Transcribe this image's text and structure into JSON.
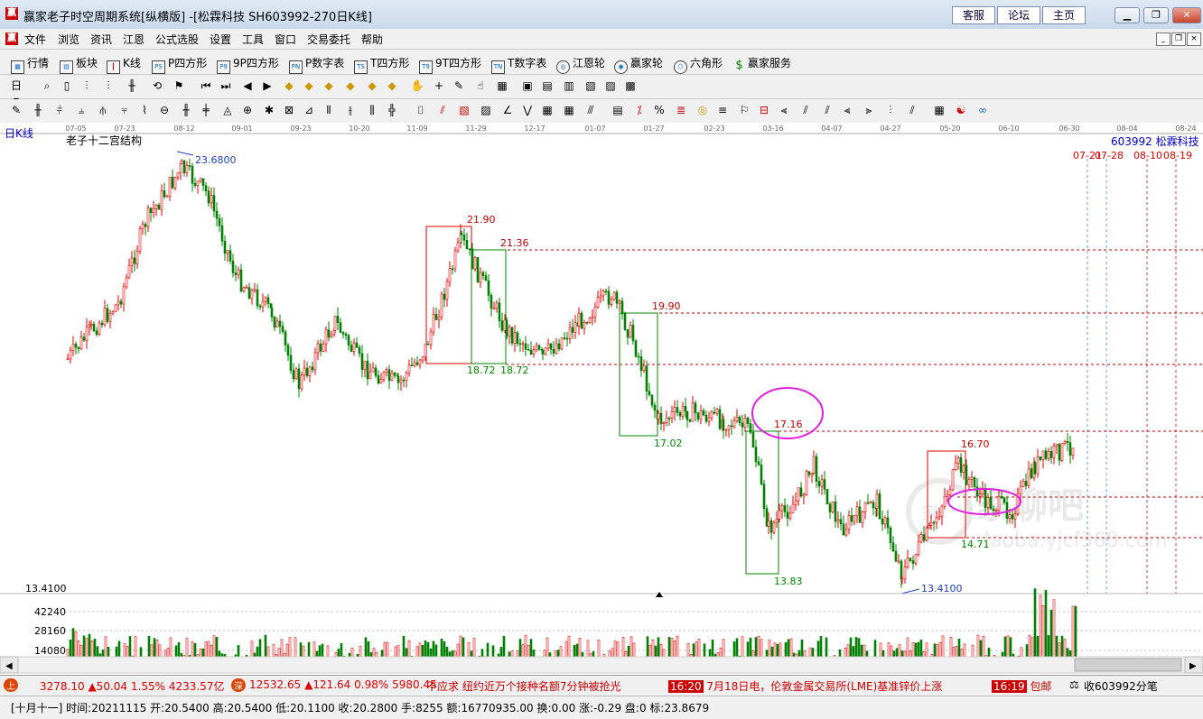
{
  "window": {
    "title": "赢家老子时空周期系统[纵横版] -[松霖科技  SH603992-270日K线]",
    "links": [
      "客服",
      "论坛",
      "主页"
    ]
  },
  "menu": [
    "文件",
    "浏览",
    "资讯",
    "江恩",
    "公式选股",
    "设置",
    "工具",
    "窗口",
    "交易委托",
    "帮助"
  ],
  "toolbar": [
    {
      "label": "行情",
      "icon": "grid-icon"
    },
    {
      "label": "板块",
      "icon": "blocks-icon"
    },
    {
      "label": "K线",
      "icon": "candlestick-icon"
    },
    {
      "label": "P四方形",
      "icon": "ps-square-icon",
      "tag": "PS"
    },
    {
      "label": "9P四方形",
      "icon": "p9-square-icon",
      "tag": "P9"
    },
    {
      "label": "P数字表",
      "icon": "pn-table-icon",
      "tag": "PN"
    },
    {
      "label": "T四方形",
      "icon": "ts-square-icon",
      "tag": "TS"
    },
    {
      "label": "9T四方形",
      "icon": "t9-square-icon",
      "tag": "T9"
    },
    {
      "label": "T数字表",
      "icon": "tn-table-icon",
      "tag": "TN"
    },
    {
      "label": "江恩轮",
      "icon": "gann-wheel-icon"
    },
    {
      "label": "赢家轮",
      "icon": "winner-wheel-icon"
    },
    {
      "label": "六角形",
      "icon": "hexagon-icon"
    },
    {
      "label": "赢家服务",
      "icon": "dollar-icon"
    }
  ],
  "chart": {
    "period_label": "日K线",
    "study_title": "老子十二宫结构",
    "code_label": "603992  松霖科技",
    "date_ticks": [
      "07-05",
      "07-23",
      "08-12",
      "09-01",
      "09-23",
      "10-20",
      "11-09",
      "11-29",
      "12-17",
      "01-07",
      "01-27",
      "02-23",
      "03-16",
      "04-07",
      "04-27",
      "05-20",
      "06-10",
      "06-30",
      "08-04",
      "08-24"
    ],
    "future_dates": [
      "07-21",
      "07-28",
      "08-10",
      "08-19"
    ],
    "left_axis_label": "13.4100",
    "volume_ticks": [
      "42240",
      "28160",
      "14080"
    ],
    "annotations": {
      "high": "23.6800",
      "low": "13.4100",
      "box1_top": "21.90",
      "box1_bottom": "18.72",
      "box2_top": "21.36",
      "box2_bottom": "18.72",
      "box3_top": "19.90",
      "box3_bottom": "17.02",
      "circle1": "17.16",
      "box4_bottom": "13.83",
      "box5_top": "16.70",
      "box5_bottom": "14.71"
    },
    "watermark_main": "家聊吧",
    "watermark_url": "laoba.yjcf360.com",
    "colors": {
      "up": "#e00000",
      "down": "#008000",
      "boxes": "#e00000",
      "dash": "#c00000",
      "ellipse": "#e020e0",
      "blue": "#2040c0"
    }
  },
  "chart_data": {
    "type": "candlestick",
    "x_axis_ticks": [
      "07-05",
      "07-23",
      "08-12",
      "09-01",
      "09-23",
      "10-20",
      "11-09",
      "11-29",
      "12-17",
      "01-07",
      "01-27",
      "02-23",
      "03-16",
      "04-07",
      "04-27",
      "05-20",
      "06-10",
      "06-30",
      "08-04",
      "08-24"
    ],
    "labels": [
      "23.6800",
      "21.90",
      "21.36",
      "19.90",
      "18.72",
      "18.72",
      "17.16",
      "17.02",
      "16.70",
      "14.71",
      "13.83",
      "13.4100"
    ],
    "volume_ticks": [
      42240,
      28160,
      14080
    ]
  },
  "status": {
    "sh_index": "3278.10",
    "sh_change": "▲50.04",
    "sh_pct": "1.55%",
    "sh_amount": "4233.57亿",
    "sz_index": "12532.65",
    "sz_change": "▲121.64",
    "sz_pct": "0.98%",
    "sz_amount": "5980.45",
    "news1": "不应求 纽约近万个接种名额7分钟被抢光",
    "news2_time": "16:20",
    "news2": "7月18日电，伦敦金属交易所(LME)基准锌价上涨",
    "news3_time": "16:19",
    "news3": "包邮",
    "tick_label": "收603992分笔"
  },
  "bottom": {
    "info": "[十月十一] 时间:20211115 开:20.5400 高:20.5400 低:20.1100 收:20.2800 手:8255 额:16770935.00 换:0.00 涨:-0.29 盘:0 标:23.8679"
  }
}
